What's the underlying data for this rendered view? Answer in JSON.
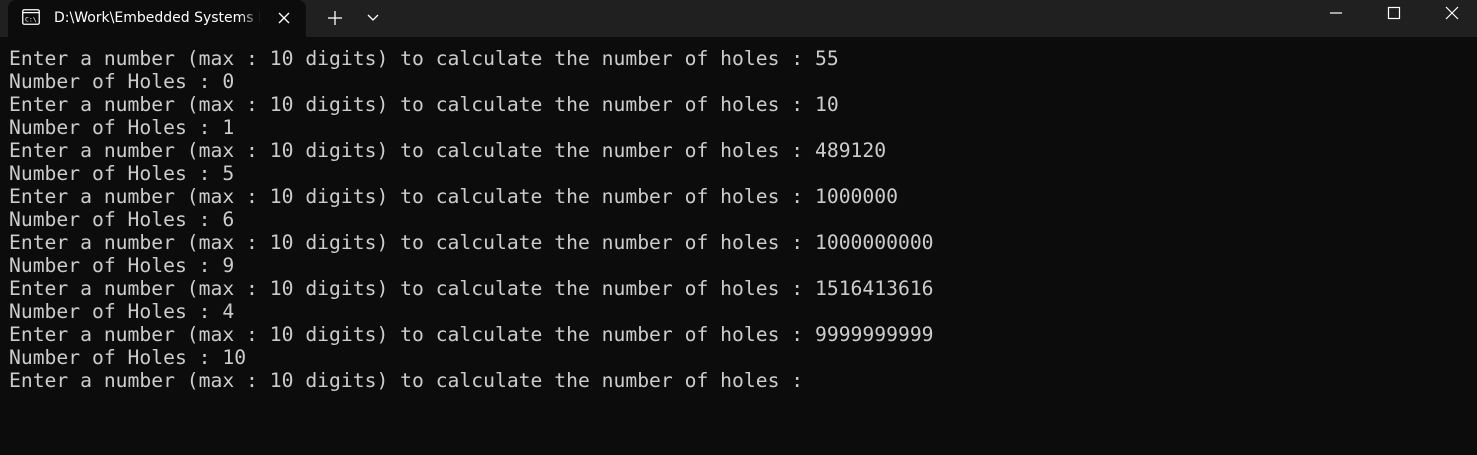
{
  "window": {
    "tab_title": "D:\\Work\\Embedded Systems I",
    "colors": {
      "titlebar_bg": "#202020",
      "console_bg": "#0c0c0c",
      "console_text": "#cccccc",
      "title_text": "#ffffff"
    },
    "icons": {
      "tab": "terminal-app-icon",
      "tab_close": "close-icon",
      "new_tab": "plus-icon",
      "dropdown": "chevron-down-icon",
      "minimize": "minimize-icon",
      "maximize": "maximize-icon",
      "close": "close-icon"
    }
  },
  "console": {
    "lines": [
      "Enter a number (max : 10 digits) to calculate the number of holes : 55",
      "Number of Holes : 0",
      "Enter a number (max : 10 digits) to calculate the number of holes : 10",
      "Number of Holes : 1",
      "Enter a number (max : 10 digits) to calculate the number of holes : 489120",
      "Number of Holes : 5",
      "Enter a number (max : 10 digits) to calculate the number of holes : 1000000",
      "Number of Holes : 6",
      "Enter a number (max : 10 digits) to calculate the number of holes : 1000000000",
      "Number of Holes : 9",
      "Enter a number (max : 10 digits) to calculate the number of holes : 1516413616",
      "Number of Holes : 4",
      "Enter a number (max : 10 digits) to calculate the number of holes : 9999999999",
      "Number of Holes : 10",
      "Enter a number (max : 10 digits) to calculate the number of holes : "
    ]
  }
}
